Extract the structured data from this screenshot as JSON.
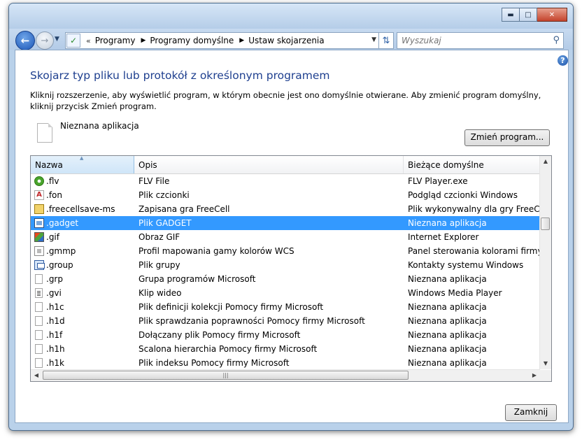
{
  "window": {
    "caption_buttons": {
      "minimize": "0",
      "maximize": "1",
      "close": "r"
    }
  },
  "nav": {
    "breadcrumbs": [
      "Programy",
      "Programy domyślne",
      "Ustaw skojarzenia"
    ],
    "search_placeholder": "Wyszukaj"
  },
  "page": {
    "heading": "Skojarz typ pliku lub protokół z określonym programem",
    "description": "Kliknij rozszerzenie, aby wyświetlić program, w którym obecnie jest ono domyślnie otwierane. Aby zmienić program domyślny, kliknij przycisk Zmień program.",
    "current_program": "Nieznana aplikacja",
    "change_button": "Zmień program...",
    "close_button": "Zamknij"
  },
  "list": {
    "columns": {
      "name": "Nazwa",
      "description": "Opis",
      "current": "Bieżące domyślne"
    },
    "rows": [
      {
        "ext": ".flv",
        "desc": "FLV File",
        "current": "FLV Player.exe",
        "icon": "flv-player-icon",
        "selected": false
      },
      {
        "ext": ".fon",
        "desc": "Plik czcionki",
        "current": "Podgląd czcionki Windows",
        "icon": "font-file-icon",
        "selected": false
      },
      {
        "ext": ".freecellsave-ms",
        "desc": "Zapisana gra FreeCell",
        "current": "Plik wykonywalny dla gry FreeCell",
        "icon": "freecell-icon",
        "selected": false
      },
      {
        "ext": ".gadget",
        "desc": "Plik GADGET",
        "current": "Nieznana aplikacja",
        "icon": "gadget-icon",
        "selected": true
      },
      {
        "ext": ".gif",
        "desc": "Obraz GIF",
        "current": "Internet Explorer",
        "icon": "gif-image-icon",
        "selected": false
      },
      {
        "ext": ".gmmp",
        "desc": "Profil mapowania gamy kolorów WCS",
        "current": "Panel sterowania kolorami firmy Mi",
        "icon": "color-profile-icon",
        "selected": false
      },
      {
        "ext": ".group",
        "desc": "Plik grupy",
        "current": "Kontakty systemu Windows",
        "icon": "contact-group-icon",
        "selected": false
      },
      {
        "ext": ".grp",
        "desc": "Grupa programów Microsoft",
        "current": "Nieznana aplikacja",
        "icon": "generic-file-icon",
        "selected": false
      },
      {
        "ext": ".gvi",
        "desc": "Klip wideo",
        "current": "Windows Media Player",
        "icon": "video-clip-icon",
        "selected": false
      },
      {
        "ext": ".h1c",
        "desc": "Plik definicji kolekcji Pomocy firmy Microsoft",
        "current": "Nieznana aplikacja",
        "icon": "generic-file-icon",
        "selected": false
      },
      {
        "ext": ".h1d",
        "desc": "Plik sprawdzania poprawności Pomocy firmy Microsoft",
        "current": "Nieznana aplikacja",
        "icon": "generic-file-icon",
        "selected": false
      },
      {
        "ext": ".h1f",
        "desc": "Dołączany plik Pomocy firmy Microsoft",
        "current": "Nieznana aplikacja",
        "icon": "generic-file-icon",
        "selected": false
      },
      {
        "ext": ".h1h",
        "desc": "Scalona hierarchia Pomocy firmy Microsoft",
        "current": "Nieznana aplikacja",
        "icon": "generic-file-icon",
        "selected": false
      },
      {
        "ext": ".h1k",
        "desc": "Plik indeksu Pomocy firmy Microsoft",
        "current": "Nieznana aplikacja",
        "icon": "generic-file-icon",
        "selected": false
      }
    ]
  }
}
